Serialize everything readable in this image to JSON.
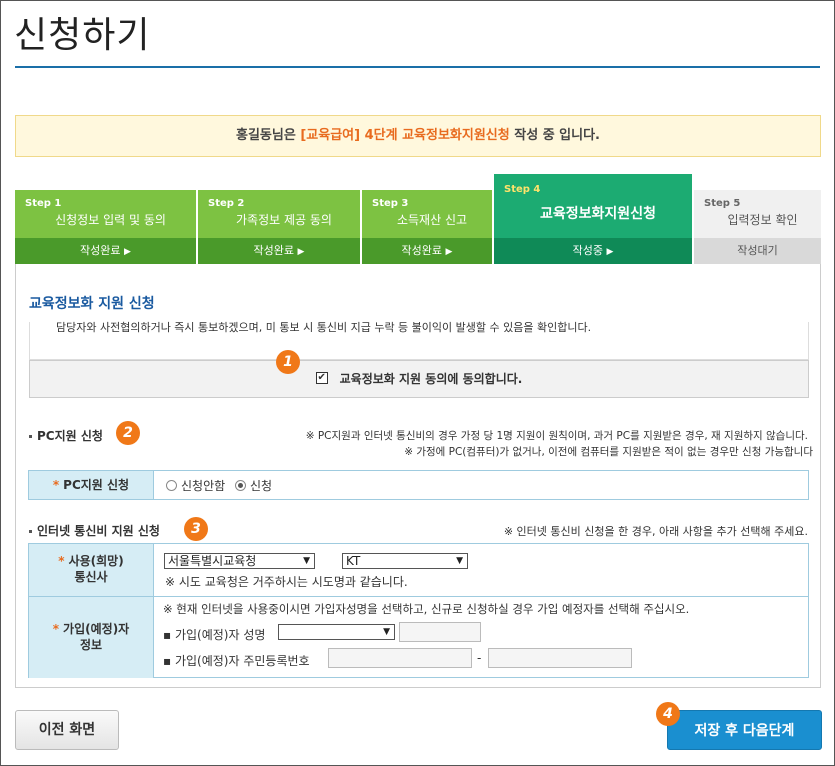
{
  "page": {
    "title": "신청하기"
  },
  "notice": {
    "name": "홍길동님은",
    "highlight": "[교육급여] 4단계 교육정보화지원신청",
    "tail": "작성 중 입니다."
  },
  "steps": [
    {
      "num": "Step 1",
      "name": "신청정보 입력 및 동의",
      "status": "작성완료"
    },
    {
      "num": "Step 2",
      "name": "가족정보 제공 동의",
      "status": "작성완료"
    },
    {
      "num": "Step 3",
      "name": "소득재산 신고",
      "status": "작성완료"
    },
    {
      "num": "Step 4",
      "name": "교육정보화지원신청",
      "status": "작성중"
    },
    {
      "num": "Step 5",
      "name": "입력정보 확인",
      "status": "작성대기"
    }
  ],
  "section": {
    "title": "교육정보화 지원 신청",
    "agree_text": "담당자와 사전협의하거나 즉시 통보하겠으며, 미 통보 시 통신비 지급 누락 등 불이익이 발생할 수 있음을 확인합니다.",
    "agree_label": "교육정보화 지원 동의에 동의합니다.",
    "agree_checked": true
  },
  "badges": [
    "1",
    "2",
    "3",
    "4"
  ],
  "pc": {
    "title": "PC지원 신청",
    "note1": "※ PC지원과 인터넷 통신비의 경우 가정 당 1명 지원이 원칙이며, 과거 PC를 지원받은 경우, 재 지원하지 않습니다.",
    "note2": "※ 가정에 PC(컴퓨터)가 없거나, 이전에 컴퓨터를 지원받은 적이 없는 경우만 신청 가능합니다",
    "label": "PC지원 신청",
    "options": [
      "신청안함",
      "신청"
    ],
    "selected": "신청"
  },
  "internet": {
    "title": "인터넷 통신비 지원 신청",
    "note": "※ 인터넷 통신비 신청을 한 경우, 아래 사항을 추가 선택해 주세요.",
    "carrier_label_1": "사용(희망)",
    "carrier_label_2": "통신사",
    "office_value": "서울특별시교육청",
    "carrier_value": "KT",
    "carrier_note": "※ 시도 교육청은 거주하시는 시도명과 같습니다.",
    "subscriber_label_1": "가입(예정)자",
    "subscriber_label_2": "정보",
    "subscriber_note": "※ 현재 인터넷을 사용중이시면 가입자성명을 선택하고, 신규로 신청하실 경우 가입 예정자를 선택해 주십시오.",
    "name_label": "가입(예정)자 성명",
    "id_label": "가입(예정)자 주민등록번호",
    "id_sep": "-"
  },
  "buttons": {
    "prev": "이전 화면",
    "next": "저장 후 다음단계"
  },
  "colors": {
    "step_done": "#7dc242",
    "step_active": "#1cab72",
    "accent": "#1a8fd0",
    "badge": "#f07818"
  }
}
